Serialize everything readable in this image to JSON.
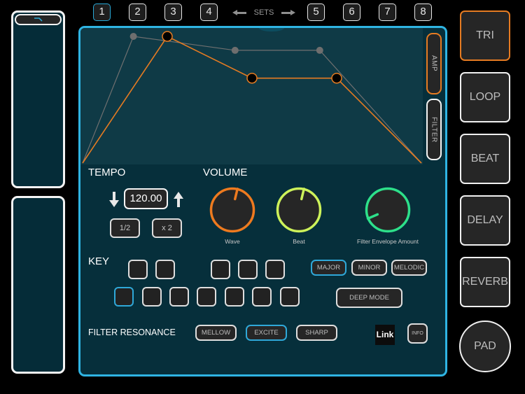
{
  "sets": {
    "label": "SETS",
    "left": [
      "1",
      "2",
      "3",
      "4"
    ],
    "right": [
      "5",
      "6",
      "7",
      "8"
    ],
    "active": "1"
  },
  "envelope": {
    "tabs": {
      "amp": "AMP",
      "filter": "FILTER"
    },
    "active_tab": "AMP",
    "colors": {
      "active": "#e57b22",
      "inactive": "#707070"
    },
    "active_points": [
      [
        0.0,
        1.0
      ],
      [
        0.25,
        0.0
      ],
      [
        0.5,
        0.33
      ],
      [
        0.75,
        0.33
      ],
      [
        1.0,
        1.0
      ]
    ],
    "ghost_points": [
      [
        0.0,
        1.0
      ],
      [
        0.15,
        0.0
      ],
      [
        0.45,
        0.11
      ],
      [
        0.7,
        0.11
      ],
      [
        1.0,
        1.0
      ]
    ]
  },
  "tempo": {
    "title": "TEMPO",
    "value": "120.00",
    "half_label": "1/2",
    "double_label": "x 2"
  },
  "volume": {
    "title": "VOLUME",
    "knobs": [
      {
        "label": "Wave",
        "color": "#ee7a1f",
        "value": 0.55
      },
      {
        "label": "Beat",
        "color": "#cdf25a",
        "value": 0.55
      },
      {
        "label": "Filter Envelope Amount",
        "color": "#2de08a",
        "value": 0.08
      }
    ]
  },
  "key": {
    "title": "KEY",
    "top_row_count": 5,
    "bottom_row_count": 7,
    "active_index": 0,
    "modes": [
      "MAJOR",
      "MINOR",
      "MELODIC"
    ],
    "active_mode": "MAJOR",
    "deep_mode": "DEEP MODE"
  },
  "filter_resonance": {
    "title": "FILTER RESONANCE",
    "options": [
      "MELLOW",
      "EXCITE",
      "SHARP"
    ],
    "active": "EXCITE"
  },
  "link_label": "Link",
  "info_label": "INFO",
  "right_buttons": [
    "TRI",
    "LOOP",
    "BEAT",
    "DELAY",
    "REVERB"
  ],
  "active_right": "TRI",
  "pad_label": "PAD"
}
